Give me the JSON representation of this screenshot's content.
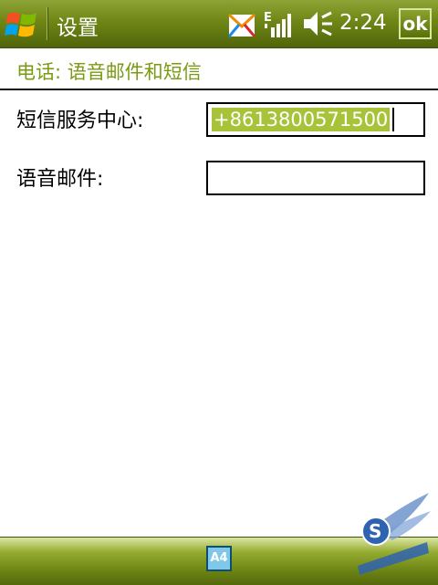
{
  "titlebar": {
    "title": "设置",
    "time": "2:24",
    "ok_label": "ok"
  },
  "page": {
    "header": "电话: 语音邮件和短信"
  },
  "form": {
    "sms_center_label": "短信服务中心:",
    "sms_center_value": "+8613800571500",
    "voicemail_label": "语音邮件:",
    "voicemail_value": ""
  },
  "bottombar": {
    "input_panel_label": "A4"
  },
  "colors": {
    "titlebar": "#6f8616",
    "header_text": "#7a9a12",
    "selection": "#a8c33a"
  }
}
